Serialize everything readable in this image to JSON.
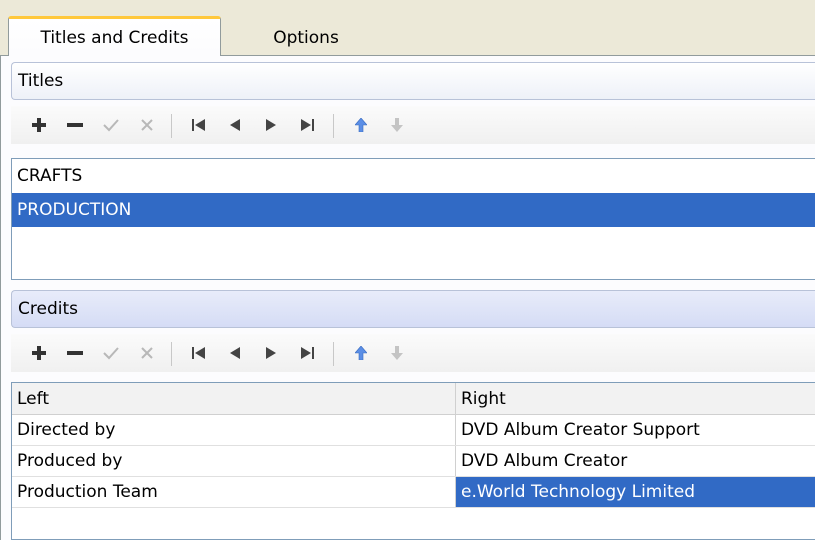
{
  "tabs": [
    {
      "label": "Titles and Credits",
      "active": true
    },
    {
      "label": "Options",
      "active": false
    }
  ],
  "titles": {
    "header": "Titles",
    "items": [
      {
        "label": "CRAFTS",
        "selected": false
      },
      {
        "label": "PRODUCTION",
        "selected": true
      }
    ]
  },
  "credits": {
    "header": "Credits",
    "columns": [
      "Left",
      "Right"
    ],
    "rows": [
      {
        "left": "Directed by",
        "right": "DVD Album Creator Support"
      },
      {
        "left": "Produced by",
        "right": "DVD Album Creator"
      },
      {
        "left": "Production Team",
        "right": "e.World Technology Limited",
        "right_selected": true
      }
    ]
  },
  "toolbar_icons": [
    "plus-icon",
    "minus-icon",
    "check-icon",
    "cancel-icon",
    "first-icon",
    "prev-icon",
    "next-icon",
    "last-icon",
    "move-up-icon",
    "move-down-icon"
  ],
  "colors": {
    "selection": "#316ac5",
    "tab_accent": "#ffc83c",
    "background": "#ece9d8"
  }
}
